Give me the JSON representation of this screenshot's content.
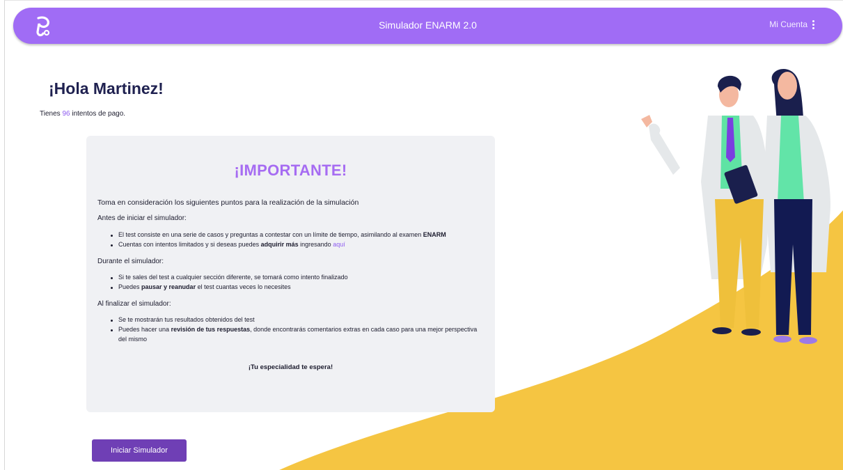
{
  "navbar": {
    "title": "Simulador ENARM 2.0",
    "account_label": "Mi Cuenta",
    "logo_icon": "stethoscope-e-logo",
    "color": "#a06cf5"
  },
  "greeting": {
    "title": "¡Hola Martinez!",
    "attempts_prefix": "Tienes",
    "attempts_count": "96",
    "attempts_suffix": "intentos de pago."
  },
  "card": {
    "title": "¡IMPORTANTE!",
    "intro": "Toma en consideración los siguientes puntos para la realización de la simulación",
    "before": {
      "heading": "Antes de iniciar el simulador:",
      "item1_text": "El test consiste en una serie de casos y preguntas a contestar con un límite de tiempo, asimilando al examen ",
      "item1_bold": "ENARM",
      "item2_text": "Cuentas con intentos limitados y si deseas puedes ",
      "item2_bold": "adquirir más",
      "item2_mid": " ingresando ",
      "item2_link": "aquí"
    },
    "during": {
      "heading": "Durante el simulador:",
      "item1_text": "Si te sales del test a cualquier sección diferente, se tomará como intento finalizado",
      "item2_pre": "Puedes ",
      "item2_bold": "pausar y reanudar",
      "item2_post": " el test cuantas veces lo necesites"
    },
    "after": {
      "heading": "Al finalizar el simulador:",
      "item1_text": "Se te mostrarán tus resultados obtenidos del test",
      "item2_pre": "Puedes hacer una ",
      "item2_bold": "revisión de tus respuestas",
      "item2_post": ", donde encontrarás comentarios extras en cada caso para una mejor perspectiva del mismo"
    },
    "closing": "¡Tu especialidad te espera!"
  },
  "actions": {
    "start_label": "Iniciar Simulador"
  },
  "colors": {
    "accent": "#a66cf2",
    "button": "#6f3fb5",
    "swoosh": "#f5c542",
    "card_bg": "#f0f1f4"
  }
}
